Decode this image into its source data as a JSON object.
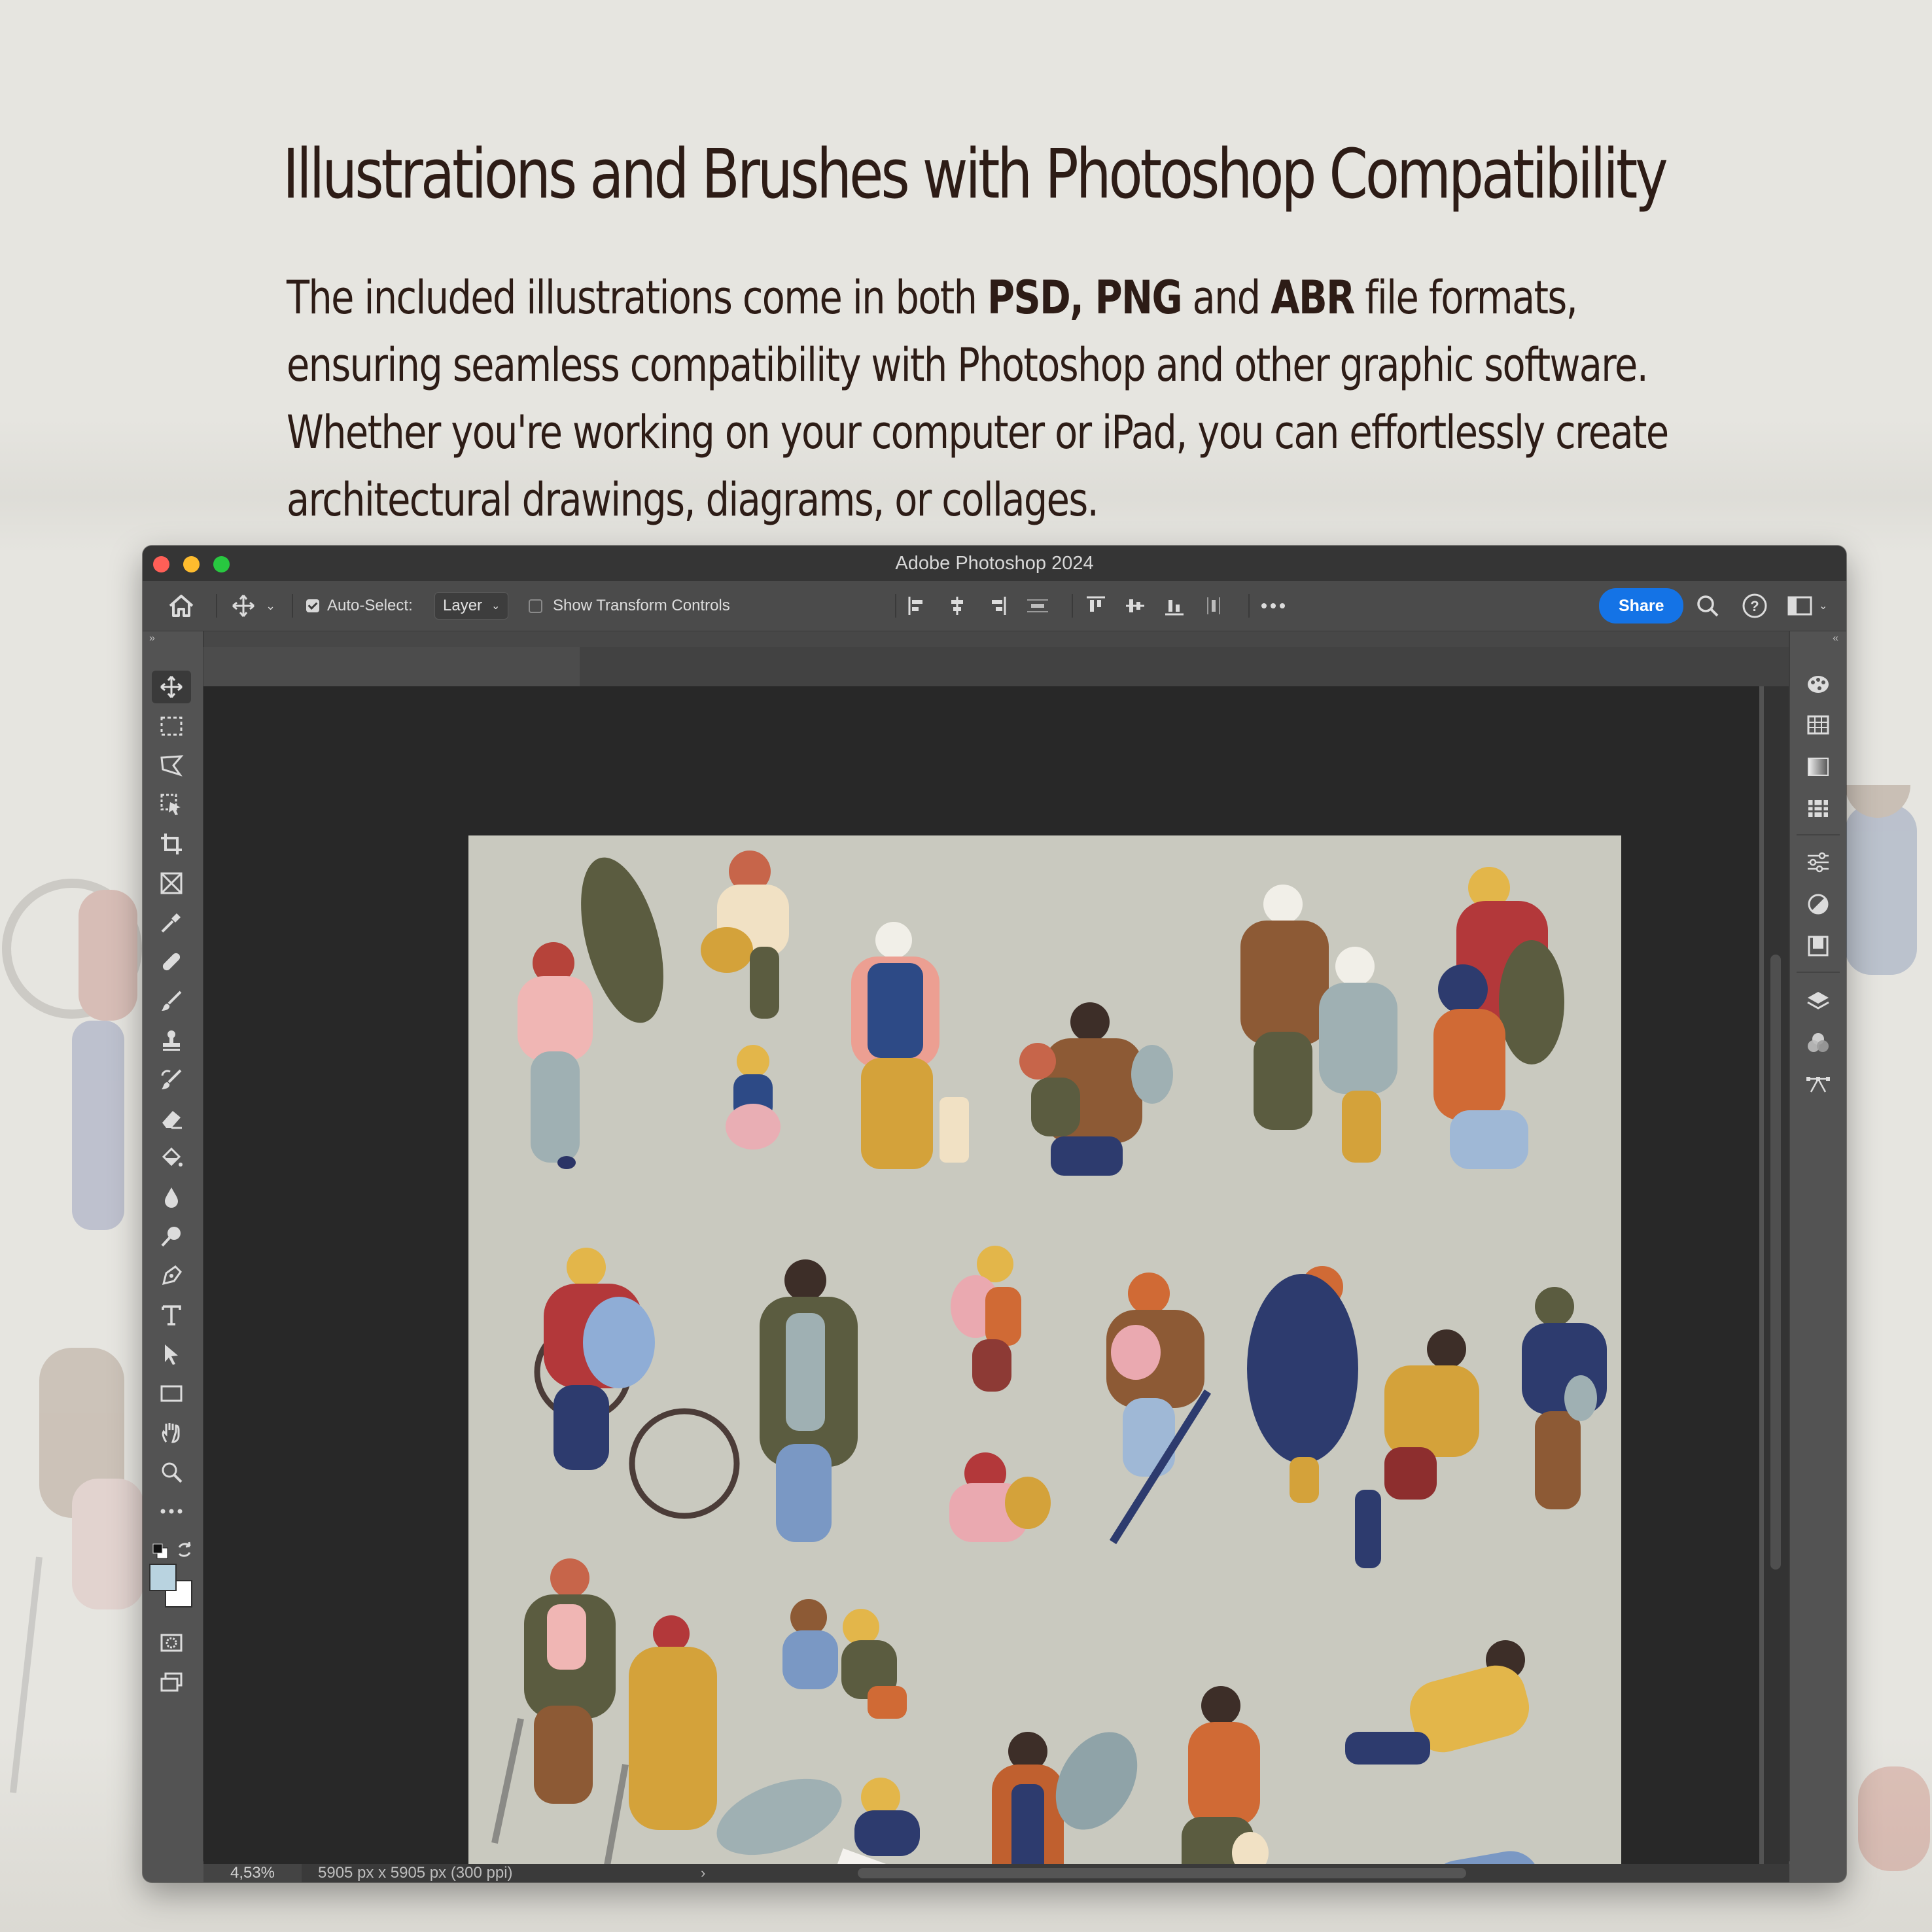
{
  "headline": "Illustrations and Brushes with Photoshop Compatibility",
  "paragraph": {
    "p1": "The included illustrations come in both ",
    "b1": "PSD, PNG",
    "p2": " and ",
    "b2": "ABR",
    "p3": " file formats, ensuring seamless compatibility with Photoshop and other graphic software. Whether you're working on your computer or iPad, you can effortlessly create architectural drawings, diagrams, or collages."
  },
  "window": {
    "title": "Adobe Photoshop 2024"
  },
  "options_bar": {
    "auto_select_label": "Auto-Select:",
    "auto_select_value": "Layer",
    "auto_select_checked": true,
    "transform_label": "Show Transform Controls",
    "transform_checked": false,
    "share_label": "Share"
  },
  "tools": [
    "move-tool",
    "marquee-tool",
    "lasso-tool",
    "object-select-tool",
    "crop-tool",
    "frame-tool",
    "eyedropper-tool",
    "healing-tool",
    "brush-tool",
    "stamp-tool",
    "history-brush-tool",
    "eraser-tool",
    "bucket-tool",
    "blur-tool",
    "dodge-tool",
    "pen-tool",
    "type-tool",
    "path-select-tool",
    "rectangle-tool",
    "hand-tool",
    "zoom-tool",
    "more-tools"
  ],
  "colors": {
    "foreground": "#b9d3e0",
    "background": "#ffffff",
    "share_button": "#1473e6",
    "canvas": "#c9c9bf"
  },
  "status_bar": {
    "zoom": "4,53%",
    "doc_info": "5905 px x 5905 px (300 ppi)"
  }
}
